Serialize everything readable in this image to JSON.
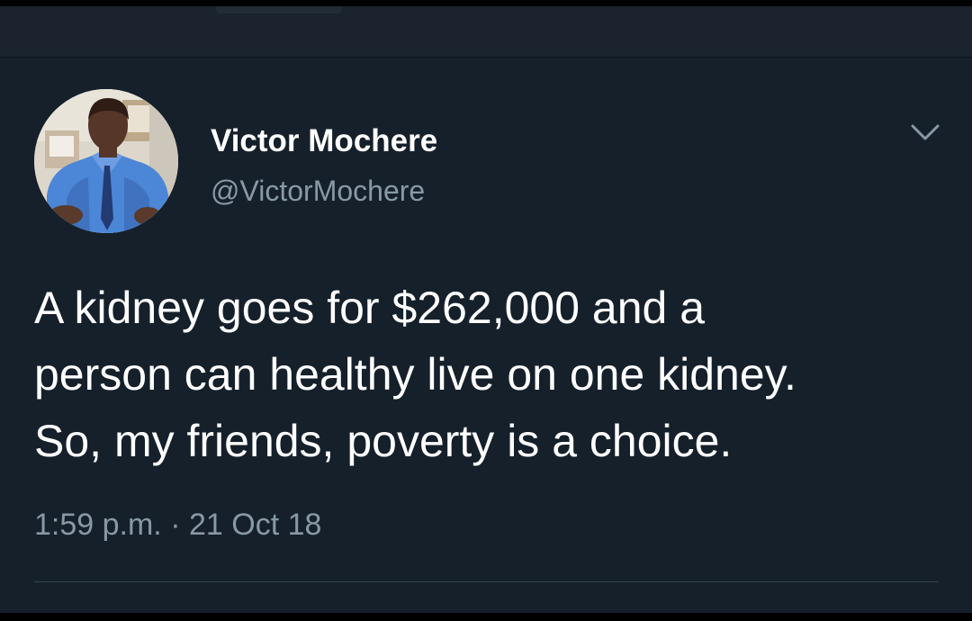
{
  "tweet": {
    "display_name": "Victor Mochere",
    "handle": "@VictorMochere",
    "text_lines": [
      "A kidney goes for $262,000 and a",
      "person can healthy live on one kidney.",
      "So, my friends, poverty is a choice."
    ],
    "time": "1:59 p.m.",
    "separator": "·",
    "date": "21 Oct 18"
  },
  "colors": {
    "background": "#15202b",
    "secondary_text": "#8899a6",
    "primary_text": "#ffffff",
    "divider": "#38444d"
  },
  "icons": {
    "more": "chevron-down-icon",
    "avatar": "profile-photo"
  }
}
